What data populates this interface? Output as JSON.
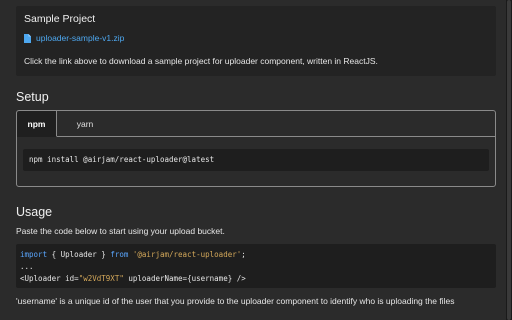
{
  "sample_project": {
    "title": "Sample Project",
    "file_link": "uploader-sample-v1.zip",
    "file_icon": "file-icon",
    "description": "Click the link above to download a sample project for uploader component, written in ReactJS."
  },
  "setup": {
    "heading": "Setup",
    "tabs": [
      {
        "label": "npm",
        "active": true
      },
      {
        "label": "yarn",
        "active": false
      }
    ],
    "install_command": "npm install @airjam/react-uploader@latest"
  },
  "usage": {
    "heading": "Usage",
    "description": "Paste the code below to start using your upload bucket.",
    "code": {
      "line1": {
        "kw1": "import",
        "mid1": " { Uploader } ",
        "kw2": "from",
        "str": "'@airjam/react-uploader'",
        "end": ";"
      },
      "line2": "...",
      "line3": {
        "pre": "<Uploader id=",
        "str": "\"w2VdT9XT\"",
        "post": " uploaderName={username} />"
      }
    },
    "note": "'username' is a unique id of the user that you provide to the uploader component to identify who is uploading the files"
  },
  "colors": {
    "link": "#4ea8f0",
    "keyword": "#5aa7ff",
    "string": "#d4a85a",
    "panel": "#2b2b2b"
  }
}
